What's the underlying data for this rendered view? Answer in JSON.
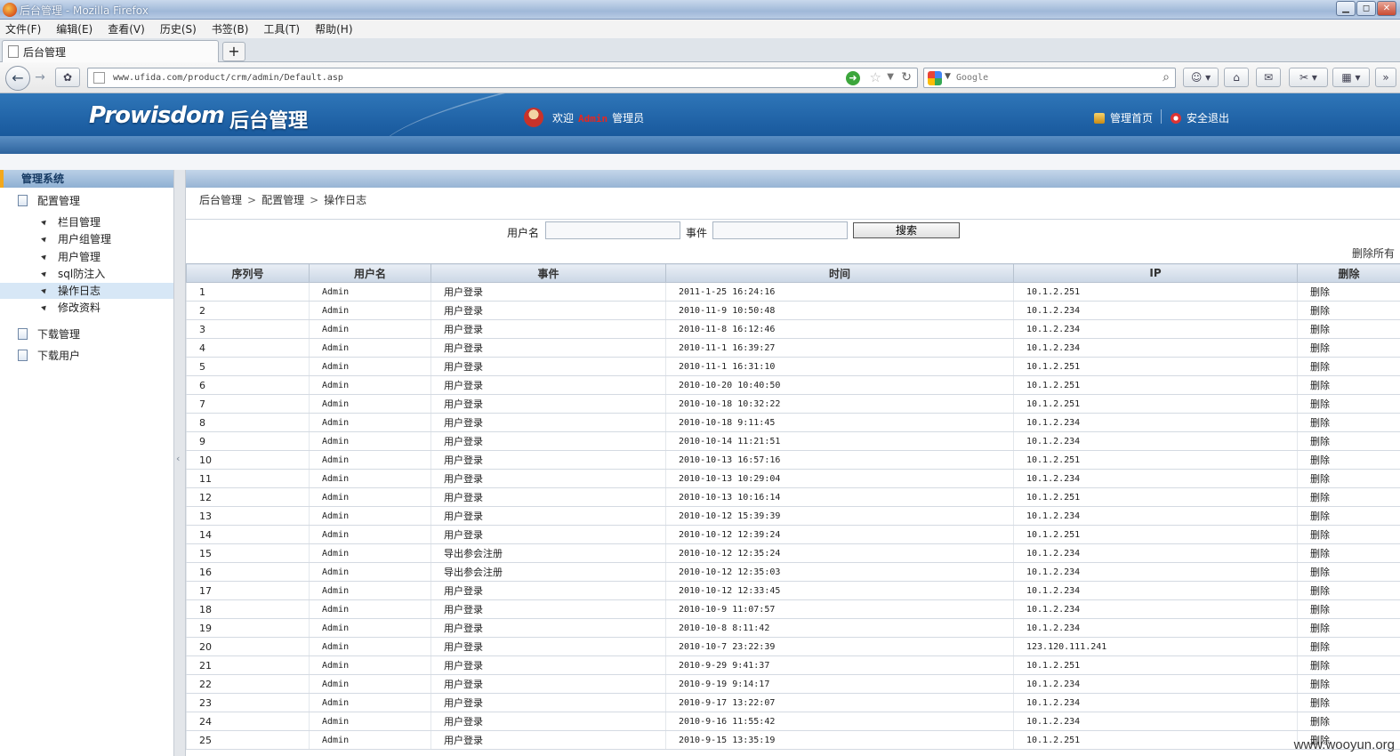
{
  "window": {
    "title": "后台管理 - Mozilla Firefox",
    "controls": [
      "▁",
      "◻",
      "✕"
    ]
  },
  "menubar": {
    "items": [
      "文件(F)",
      "编辑(E)",
      "查看(V)",
      "历史(S)",
      "书签(B)",
      "工具(T)",
      "帮助(H)"
    ]
  },
  "tabs": {
    "active_label": "后台管理",
    "new_tab_label": "+"
  },
  "navbar": {
    "url": "www.ufida.com/product/crm/admin/Default.asp",
    "search_placeholder": "Google",
    "back_icon": "←",
    "forward_icon": "→"
  },
  "header": {
    "brand": "Prowisdom",
    "brand_sub": "后台管理",
    "welcome_prefix": "欢迎",
    "username": "Admin",
    "welcome_suffix": "管理员",
    "home_link": "管理首页",
    "logout_link": "安全退出"
  },
  "sidebar": {
    "title": "管理系统",
    "group1": "配置管理",
    "items": [
      "栏目管理",
      "用户组管理",
      "用户管理",
      "sql防注入",
      "操作日志",
      "修改资料"
    ],
    "active_index": 4,
    "group2": "下载管理",
    "group3": "下载用户"
  },
  "breadcrumb": [
    "后台管理",
    "配置管理",
    "操作日志"
  ],
  "search": {
    "username_label": "用户名",
    "event_label": "事件",
    "button_label": "搜索"
  },
  "delete_all_label": "删除所有",
  "table": {
    "columns": [
      "序列号",
      "用户名",
      "事件",
      "时间",
      "IP",
      "删除"
    ],
    "rows": [
      [
        "1",
        "Admin",
        "用户登录",
        "2011-1-25 16:24:16",
        "10.1.2.251",
        "删除"
      ],
      [
        "2",
        "Admin",
        "用户登录",
        "2010-11-9 10:50:48",
        "10.1.2.234",
        "删除"
      ],
      [
        "3",
        "Admin",
        "用户登录",
        "2010-11-8 16:12:46",
        "10.1.2.234",
        "删除"
      ],
      [
        "4",
        "Admin",
        "用户登录",
        "2010-11-1 16:39:27",
        "10.1.2.234",
        "删除"
      ],
      [
        "5",
        "Admin",
        "用户登录",
        "2010-11-1 16:31:10",
        "10.1.2.251",
        "删除"
      ],
      [
        "6",
        "Admin",
        "用户登录",
        "2010-10-20 10:40:50",
        "10.1.2.251",
        "删除"
      ],
      [
        "7",
        "Admin",
        "用户登录",
        "2010-10-18 10:32:22",
        "10.1.2.251",
        "删除"
      ],
      [
        "8",
        "Admin",
        "用户登录",
        "2010-10-18 9:11:45",
        "10.1.2.234",
        "删除"
      ],
      [
        "9",
        "Admin",
        "用户登录",
        "2010-10-14 11:21:51",
        "10.1.2.234",
        "删除"
      ],
      [
        "10",
        "Admin",
        "用户登录",
        "2010-10-13 16:57:16",
        "10.1.2.251",
        "删除"
      ],
      [
        "11",
        "Admin",
        "用户登录",
        "2010-10-13 10:29:04",
        "10.1.2.234",
        "删除"
      ],
      [
        "12",
        "Admin",
        "用户登录",
        "2010-10-13 10:16:14",
        "10.1.2.251",
        "删除"
      ],
      [
        "13",
        "Admin",
        "用户登录",
        "2010-10-12 15:39:39",
        "10.1.2.234",
        "删除"
      ],
      [
        "14",
        "Admin",
        "用户登录",
        "2010-10-12 12:39:24",
        "10.1.2.251",
        "删除"
      ],
      [
        "15",
        "Admin",
        "导出参会注册",
        "2010-10-12 12:35:24",
        "10.1.2.234",
        "删除"
      ],
      [
        "16",
        "Admin",
        "导出参会注册",
        "2010-10-12 12:35:03",
        "10.1.2.234",
        "删除"
      ],
      [
        "17",
        "Admin",
        "用户登录",
        "2010-10-12 12:33:45",
        "10.1.2.234",
        "删除"
      ],
      [
        "18",
        "Admin",
        "用户登录",
        "2010-10-9 11:07:57",
        "10.1.2.234",
        "删除"
      ],
      [
        "19",
        "Admin",
        "用户登录",
        "2010-10-8 8:11:42",
        "10.1.2.234",
        "删除"
      ],
      [
        "20",
        "Admin",
        "用户登录",
        "2010-10-7 23:22:39",
        "123.120.111.241",
        "删除"
      ],
      [
        "21",
        "Admin",
        "用户登录",
        "2010-9-29 9:41:37",
        "10.1.2.251",
        "删除"
      ],
      [
        "22",
        "Admin",
        "用户登录",
        "2010-9-19 9:14:17",
        "10.1.2.234",
        "删除"
      ],
      [
        "23",
        "Admin",
        "用户登录",
        "2010-9-17 13:22:07",
        "10.1.2.234",
        "删除"
      ],
      [
        "24",
        "Admin",
        "用户登录",
        "2010-9-16 11:55:42",
        "10.1.2.234",
        "删除"
      ],
      [
        "25",
        "Admin",
        "用户登录",
        "2010-9-15 13:35:19",
        "10.1.2.251",
        "删除"
      ]
    ]
  },
  "watermark": "www.wooyun.org",
  "colors": {
    "header_blue": "#1d5fa3",
    "username_red": "#e8261f",
    "sidebar_active": "#d7e7f6",
    "sidebar_accent": "#f3a81c"
  }
}
